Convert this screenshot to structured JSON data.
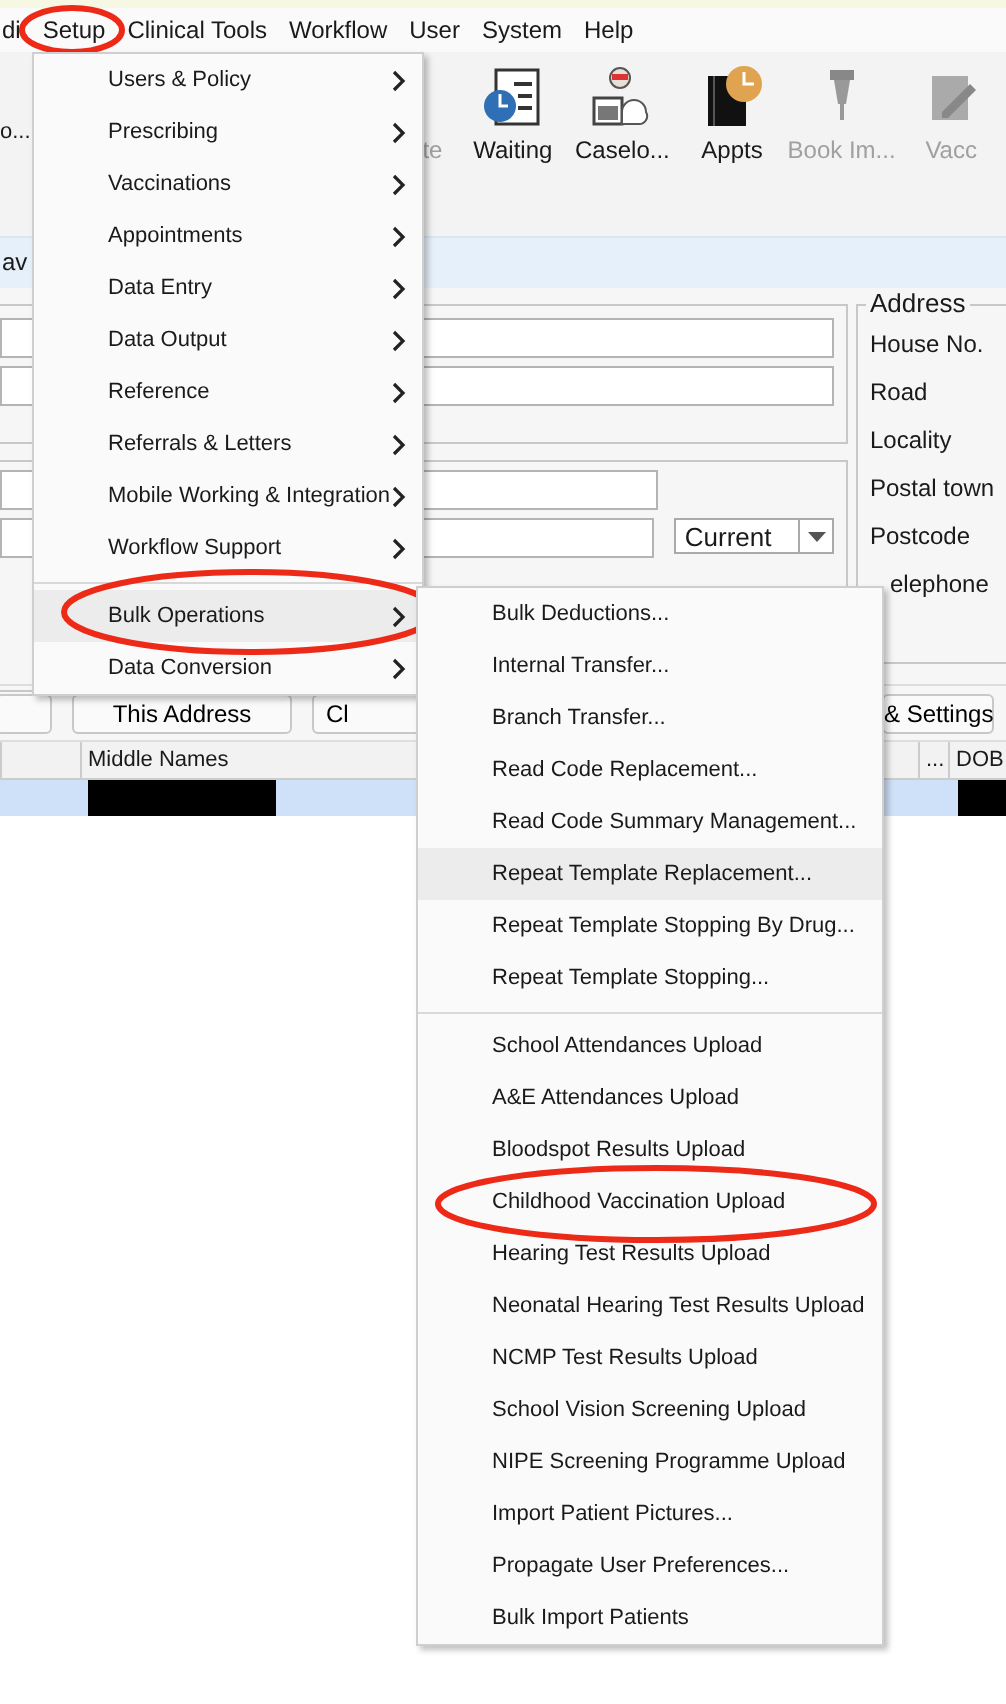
{
  "menu_bar": [
    {
      "label": "di",
      "circled": false
    },
    {
      "label": "Setup",
      "circled": true
    },
    {
      "label": "Clinical Tools",
      "circled": false
    },
    {
      "label": "Workflow",
      "circled": false
    },
    {
      "label": "User",
      "circled": false
    },
    {
      "label": "System",
      "circled": false
    },
    {
      "label": "Help",
      "circled": false
    }
  ],
  "toolbar": [
    {
      "label": "o...",
      "disabled": false
    },
    {
      "label": "te",
      "disabled": true
    },
    {
      "label": "Waiting",
      "kind": "clipboard-clock",
      "disabled": false
    },
    {
      "label": "Caselo...",
      "kind": "person-calendar",
      "disabled": false
    },
    {
      "label": "Appts",
      "kind": "book-clock",
      "disabled": false
    },
    {
      "label": "Book Im...",
      "kind": "syringe",
      "disabled": true
    },
    {
      "label": "Vacc",
      "kind": "notepad",
      "disabled": true
    }
  ],
  "favourites_bar": {
    "label": "av"
  },
  "status_dropdown": {
    "value": "Current"
  },
  "address": {
    "title": "Address",
    "labels": [
      "House No.",
      "Road",
      "Locality",
      "Postal town",
      "Postcode",
      "elephone"
    ]
  },
  "buttons": [
    {
      "kind": "stub"
    },
    {
      "kind": "normal",
      "label": "This Address"
    },
    {
      "kind": "normal",
      "label": "Cl"
    },
    {
      "kind": "normal",
      "label": "& Settings"
    }
  ],
  "table": {
    "columns": [
      "",
      "Middle Names",
      "...",
      "DOB"
    ],
    "rows": [
      {
        "selected": true
      }
    ]
  },
  "setup_menu": {
    "items": [
      {
        "kind": "item",
        "label": "Users & Policy",
        "submenu": true,
        "selected": false,
        "circled": false
      },
      {
        "kind": "item",
        "label": "Prescribing",
        "submenu": true,
        "selected": false,
        "circled": false
      },
      {
        "kind": "item",
        "label": "Vaccinations",
        "submenu": true,
        "selected": false,
        "circled": false
      },
      {
        "kind": "item",
        "label": "Appointments",
        "submenu": true,
        "selected": false,
        "circled": false
      },
      {
        "kind": "item",
        "label": "Data Entry",
        "submenu": true,
        "selected": false,
        "circled": false
      },
      {
        "kind": "item",
        "label": "Data Output",
        "submenu": true,
        "selected": false,
        "circled": false
      },
      {
        "kind": "item",
        "label": "Reference",
        "submenu": true,
        "selected": false,
        "circled": false
      },
      {
        "kind": "item",
        "label": "Referrals & Letters",
        "submenu": true,
        "selected": false,
        "circled": false
      },
      {
        "kind": "item",
        "label": "Mobile Working & Integration",
        "submenu": true,
        "selected": false,
        "circled": false
      },
      {
        "kind": "item",
        "label": "Workflow Support",
        "submenu": true,
        "selected": false,
        "circled": false
      },
      {
        "kind": "separator"
      },
      {
        "kind": "item",
        "label": "Bulk Operations",
        "submenu": true,
        "selected": true,
        "circled": true
      },
      {
        "kind": "item",
        "label": "Data Conversion",
        "submenu": true,
        "selected": false,
        "circled": false
      }
    ]
  },
  "bulk_operations_menu": {
    "items": [
      {
        "kind": "item",
        "label": "Bulk Deductions...",
        "selected": false,
        "circled": false
      },
      {
        "kind": "item",
        "label": "Internal Transfer...",
        "selected": false,
        "circled": false
      },
      {
        "kind": "item",
        "label": "Branch Transfer...",
        "selected": false,
        "circled": false
      },
      {
        "kind": "item",
        "label": "Read Code Replacement...",
        "selected": false,
        "circled": false
      },
      {
        "kind": "item",
        "label": "Read Code Summary Management...",
        "selected": false,
        "circled": false
      },
      {
        "kind": "item",
        "label": "Repeat Template Replacement...",
        "selected": true,
        "circled": false
      },
      {
        "kind": "item",
        "label": "Repeat Template Stopping By Drug...",
        "selected": false,
        "circled": false
      },
      {
        "kind": "item",
        "label": "Repeat Template Stopping...",
        "selected": false,
        "circled": false
      },
      {
        "kind": "separator"
      },
      {
        "kind": "item",
        "label": "School Attendances Upload",
        "selected": false,
        "circled": false
      },
      {
        "kind": "item",
        "label": "A&E Attendances Upload",
        "selected": false,
        "circled": false
      },
      {
        "kind": "item",
        "label": "Bloodspot Results Upload",
        "selected": false,
        "circled": false
      },
      {
        "kind": "item",
        "label": "Childhood Vaccination Upload",
        "selected": false,
        "circled": true
      },
      {
        "kind": "item",
        "label": "Hearing Test Results Upload",
        "selected": false,
        "circled": false
      },
      {
        "kind": "item",
        "label": "Neonatal Hearing Test Results Upload",
        "selected": false,
        "circled": false
      },
      {
        "kind": "item",
        "label": "NCMP Test Results Upload",
        "selected": false,
        "circled": false
      },
      {
        "kind": "item",
        "label": "School Vision Screening Upload",
        "selected": false,
        "circled": false
      },
      {
        "kind": "item",
        "label": "NIPE Screening Programme Upload",
        "selected": false,
        "circled": false
      },
      {
        "kind": "item",
        "label": "Import Patient Pictures...",
        "selected": false,
        "circled": false
      },
      {
        "kind": "item",
        "label": "Propagate User Preferences...",
        "selected": false,
        "circled": false
      },
      {
        "kind": "item",
        "label": "Bulk Import Patients",
        "selected": false,
        "circled": false
      }
    ]
  }
}
